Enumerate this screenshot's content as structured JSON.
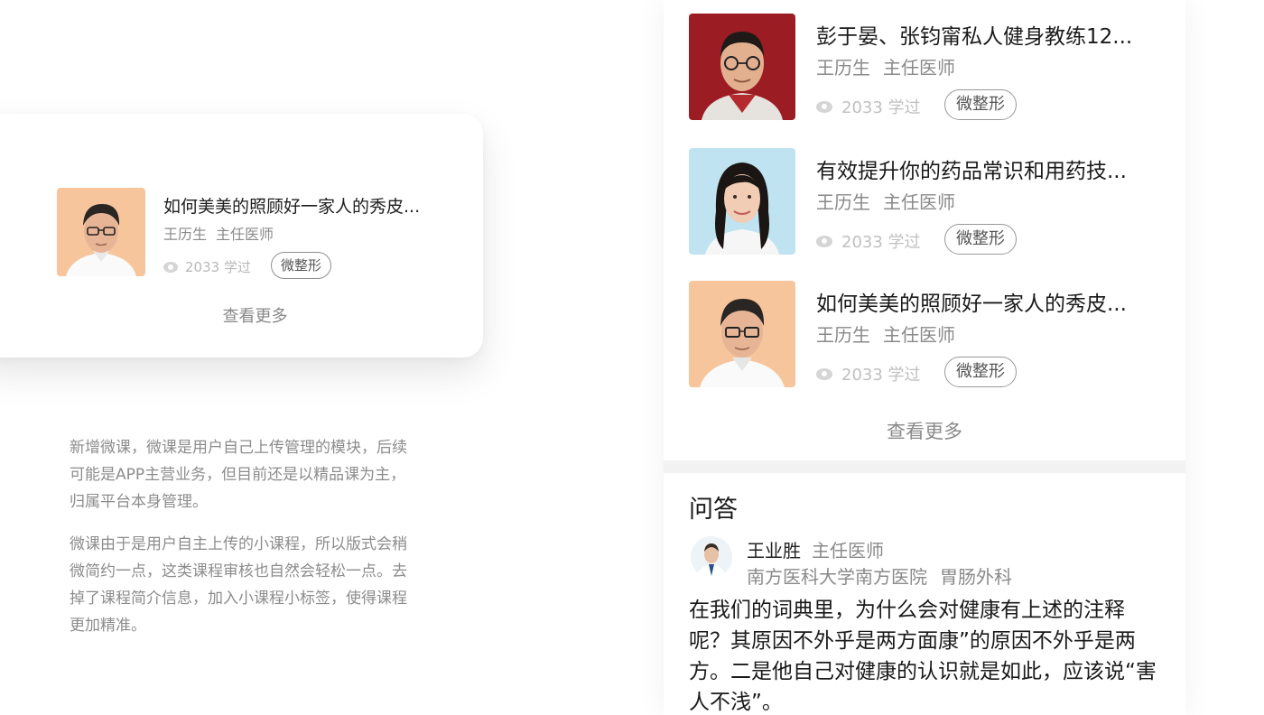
{
  "left_card": {
    "course": {
      "title": "如何美美的照顾好一家人的秀皮...",
      "author_name": "王历生",
      "author_role": "主任医师",
      "views": "2033 学过",
      "tag": "微整形"
    },
    "more": "查看更多"
  },
  "description": {
    "paragraphs": [
      "新增微课，微课是用户自己上传管理的模块，后续可能是APP主营业务，但目前还是以精品课为主，归属平台本身管理。",
      "微课由于是用户自主上传的小课程，所以版式会稍微简约一点，这类课程审核也自然会轻松一点。去掉了课程简介信息，加入小课程小标签，使得课程更加精准。"
    ]
  },
  "courses": [
    {
      "title": "彭于晏、张钧甯私人健身教练12...",
      "author_name": "王历生",
      "author_role": "主任医师",
      "views": "2033 学过",
      "tag": "微整形",
      "bg": "#9b1c22"
    },
    {
      "title": "有效提升你的药品常识和用药技...",
      "author_name": "王历生",
      "author_role": "主任医师",
      "views": "2033 学过",
      "tag": "微整形",
      "bg": "#bfe3f0"
    },
    {
      "title": "如何美美的照顾好一家人的秀皮...",
      "author_name": "王历生",
      "author_role": "主任医师",
      "views": "2033 学过",
      "tag": "微整形",
      "bg": "#f6c59c"
    }
  ],
  "courses_more": "查看更多",
  "qa": {
    "title": "问答",
    "doctor_name": "王业胜",
    "doctor_role": "主任医师",
    "hospital": "南方医科大学南方医院",
    "department": "胃肠外科",
    "content": "在我们的词典里，为什么会对健康有上述的注释呢？其原因不外乎是两方面康”的原因不外乎是两方。二是他自己对健康的认识就是如此，应该说“害人不浅”。"
  }
}
